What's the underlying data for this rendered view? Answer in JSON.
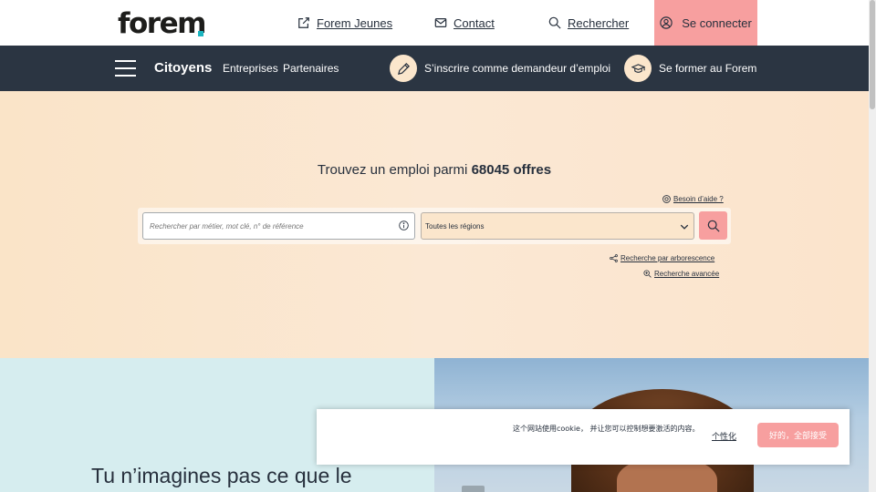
{
  "header": {
    "logo_text": "forem",
    "links": {
      "jeunes": "Forem Jeunes",
      "contact": "Contact",
      "search": "Rechercher"
    },
    "login": "Se connecter"
  },
  "nav": {
    "citoyens": "Citoyens",
    "entreprises": "Entreprises",
    "partenaires": "Partenaires",
    "cta_register": "S’inscrire comme demandeur d’emploi",
    "cta_training": "Se former au Forem"
  },
  "hero": {
    "title_prefix": "Trouvez un emploi parmi ",
    "offers_count": "68045 offres",
    "help_link": "Besoin d’aide ?",
    "search_placeholder": "Rechercher par métier, mot clé, n° de référence",
    "region_selected": "Toutes les régions",
    "tree_search": "Recherche par arborescence",
    "advanced_search": "Recherche avancée"
  },
  "promo": {
    "heading": "Tu n’imagines pas ce que le"
  },
  "cookie": {
    "message": "这个网站使用cookie， 并让您可以控制想要激活的内容。",
    "personalize": "个性化",
    "accept": "好的，全部接受"
  },
  "colors": {
    "navbar": "#2b3542",
    "accent_pink": "#f79f9f",
    "hero_bg": "#fbe6cc",
    "promo_bg": "#d6edef",
    "logo_dot": "#1cb5c0"
  }
}
